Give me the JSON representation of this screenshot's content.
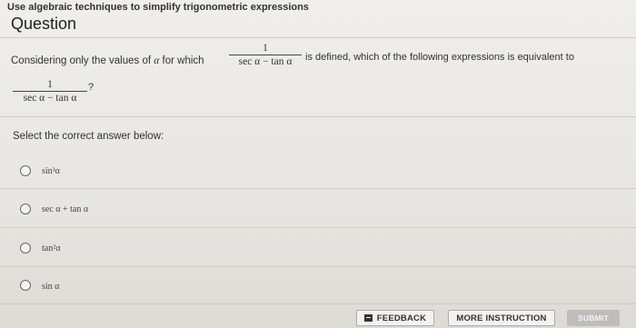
{
  "header": {
    "topic": "Use algebraic techniques to simplify trigonometric expressions",
    "title": "Question"
  },
  "question": {
    "text_before": "Considering only the values of",
    "variable": "α",
    "text_mid": "for which",
    "fraction_num": "1",
    "fraction_den": "sec α − tan α",
    "text_after": "is defined, which of the following expressions is equivalent to",
    "fraction2_num": "1",
    "fraction2_den": "sec α − tan α",
    "question_mark": "?"
  },
  "prompt": "Select the correct answer below:",
  "options": [
    {
      "label": "sin³α"
    },
    {
      "label": "sec α + tan α"
    },
    {
      "label": "tan²α"
    },
    {
      "label": "sin α"
    }
  ],
  "footer": {
    "feedback_label": "FEEDBACK",
    "more_label": "MORE INSTRUCTION",
    "submit_label": "SUBMIT"
  }
}
